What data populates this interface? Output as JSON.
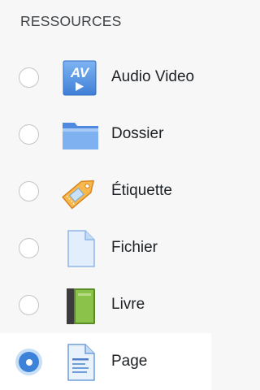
{
  "section": {
    "heading": "RESSOURCES"
  },
  "resources": [
    {
      "label": "Audio Video",
      "icon": "audio-video-icon",
      "selected": false
    },
    {
      "label": "Dossier",
      "icon": "folder-icon",
      "selected": false
    },
    {
      "label": "Étiquette",
      "icon": "tag-icon",
      "selected": false
    },
    {
      "label": "Fichier",
      "icon": "file-icon",
      "selected": false
    },
    {
      "label": "Livre",
      "icon": "book-icon",
      "selected": false
    },
    {
      "label": "Page",
      "icon": "page-icon",
      "selected": true
    }
  ],
  "colors": {
    "radio_selected": "#3b82d8",
    "folder_blue": "#6ea4ec",
    "tag_orange": "#f3a43b",
    "book_green": "#8bc34a"
  }
}
